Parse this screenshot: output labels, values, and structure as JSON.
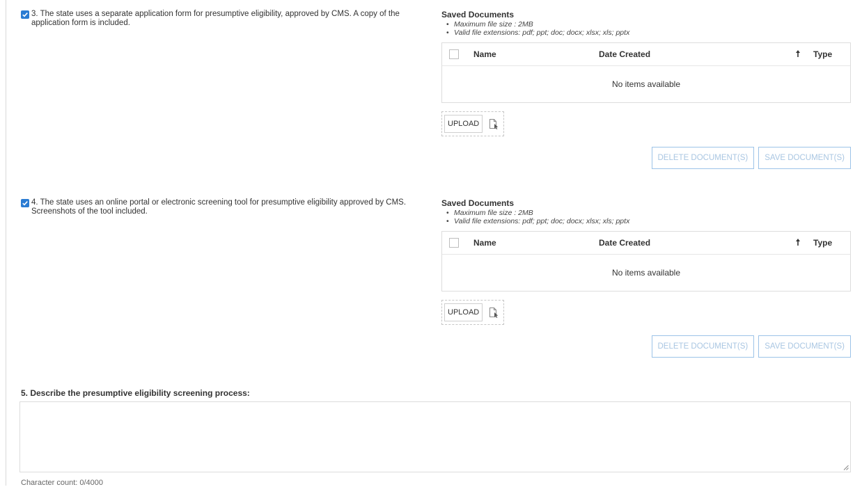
{
  "items": [
    {
      "checked": true,
      "question": "3. The state uses a separate application form for presumptive eligibility, approved by CMS. A copy of the application form is included.",
      "saved_title": "Saved Documents",
      "rules": [
        "Maximum file size : 2MB",
        "Valid file extensions: pdf; ppt; doc; docx; xlsx; xls; pptx"
      ],
      "columns": {
        "name": "Name",
        "date": "Date Created",
        "type": "Type"
      },
      "sort_icon": "arrow-up-icon",
      "empty_text": "No items available",
      "upload_label": "UPLOAD",
      "delete_label": "DELETE DOCUMENT(S)",
      "save_label": "SAVE DOCUMENT(S)"
    },
    {
      "checked": true,
      "question": "4. The state uses an online portal or electronic screening tool for presumptive eligibility approved by CMS. Screenshots of the tool included.",
      "saved_title": "Saved Documents",
      "rules": [
        "Maximum file size : 2MB",
        "Valid file extensions: pdf; ppt; doc; docx; xlsx; xls; pptx"
      ],
      "columns": {
        "name": "Name",
        "date": "Date Created",
        "type": "Type"
      },
      "sort_icon": "arrow-up-icon",
      "empty_text": "No items available",
      "upload_label": "UPLOAD",
      "delete_label": "DELETE DOCUMENT(S)",
      "save_label": "SAVE DOCUMENT(S)"
    }
  ],
  "q5": {
    "label": "5. Describe the presumptive eligibility screening process:",
    "value": "",
    "char_count": "Character count: 0/4000"
  },
  "colors": {
    "accent": "#2b7cd3",
    "disabled_text": "#a9c6e2",
    "disabled_border": "#9cc3e8"
  }
}
